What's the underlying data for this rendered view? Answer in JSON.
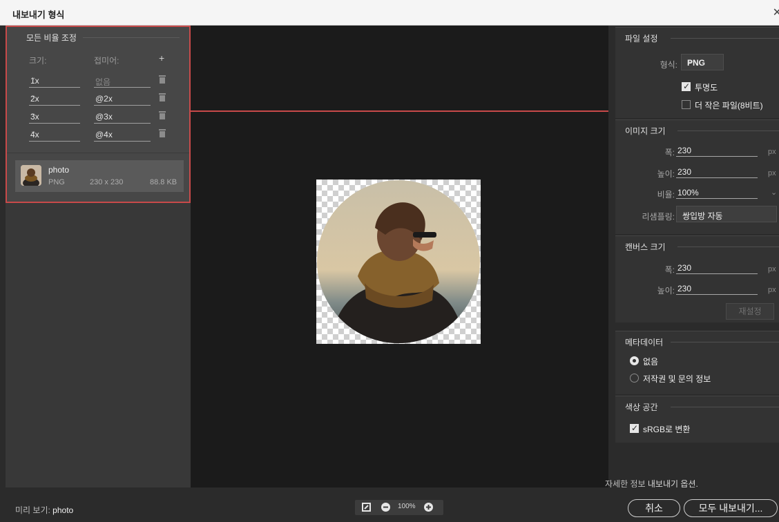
{
  "window": {
    "title": "내보내기 형식",
    "close_glyph": "✕"
  },
  "scale_panel": {
    "title": "모든 비율 조정",
    "size_header": "크기:",
    "suffix_header": "접미어:",
    "add_glyph": "+",
    "rows": [
      {
        "size": "1x",
        "suffix": "",
        "suffix_placeholder": "없음"
      },
      {
        "size": "2x",
        "suffix": "@2x"
      },
      {
        "size": "3x",
        "suffix": "@3x"
      },
      {
        "size": "4x",
        "suffix": "@4x"
      }
    ]
  },
  "file": {
    "name": "photo",
    "format": "PNG",
    "dimensions": "230 x 230",
    "size": "88.8 KB"
  },
  "file_settings": {
    "title": "파일 설정",
    "format_label": "형식:",
    "format_value": "PNG",
    "transparency_label": "투명도",
    "transparency_checked": true,
    "smaller_file_label": "더 작은 파일(8비트)",
    "smaller_file_checked": false
  },
  "image_size": {
    "title": "이미지 크기",
    "width_label": "폭:",
    "width_value": "230",
    "height_label": "높이:",
    "height_value": "230",
    "unit": "px",
    "scale_label": "비율:",
    "scale_value": "100%",
    "resample_label": "리샘플링:",
    "resample_value": "쌍입방 자동"
  },
  "canvas_size": {
    "title": "캔버스 크기",
    "width_label": "폭:",
    "width_value": "230",
    "height_label": "높이:",
    "height_value": "230",
    "unit": "px",
    "reset_label": "재설정"
  },
  "metadata": {
    "title": "메타데이터",
    "options": [
      "없음",
      "저작권 및 문의 정보"
    ],
    "selected": "없음"
  },
  "color_space": {
    "title": "색상 공간",
    "convert_label": "sRGB로 변환",
    "convert_checked": true
  },
  "more_info": {
    "prefix": "자세한 정보 ",
    "link": "내보내기 옵션."
  },
  "footer": {
    "preview_prefix": "미리 보기: ",
    "preview_name": "photo",
    "zoom": "100%",
    "cancel_label": "취소",
    "export_all_label": "모두 내보내기..."
  },
  "colors": {
    "highlight": "#c94a4a",
    "canvas_bg": "#1b1b1b",
    "panel_bg": "#333333"
  },
  "icons": {
    "zoom_out": "minus-circle-icon",
    "zoom_in": "plus-circle-icon",
    "fit": "fit-screen-icon",
    "delete": "trash-icon",
    "dropdown": "chevron-down-icon"
  }
}
